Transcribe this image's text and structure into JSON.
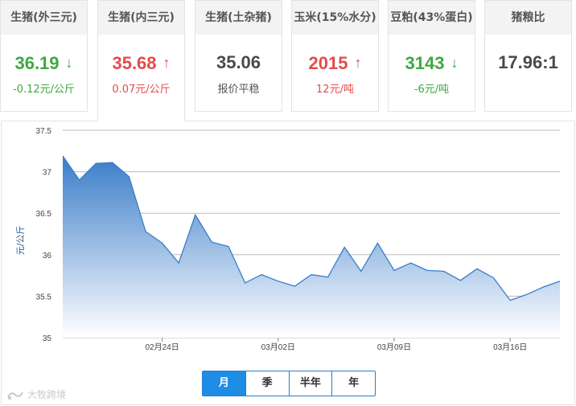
{
  "cards": [
    {
      "id": "pig-outer",
      "title": "生猪(外三元)",
      "value": "36.19",
      "trend": "down",
      "change": "-0.12元/公斤",
      "active": false
    },
    {
      "id": "pig-inner",
      "title": "生猪(内三元)",
      "value": "35.68",
      "trend": "up",
      "change": "0.07元/公斤",
      "active": true
    },
    {
      "id": "pig-local",
      "title": "生猪(土杂猪)",
      "value": "35.06",
      "trend": "flat",
      "change": "报价平稳",
      "active": false
    },
    {
      "id": "corn",
      "title": "玉米(15%水分)",
      "value": "2015",
      "trend": "up",
      "change": "12元/吨",
      "active": false
    },
    {
      "id": "soymeal",
      "title": "豆粕(43%蛋白)",
      "value": "3143",
      "trend": "down",
      "change": "-6元/吨",
      "active": false
    },
    {
      "id": "ratio",
      "title": "猪粮比",
      "value": "17.96:1",
      "trend": "none",
      "change": "",
      "active": false
    }
  ],
  "icons": {
    "up": "arrow-up-icon",
    "down": "arrow-down-icon",
    "logo": "watermark-logo-icon"
  },
  "colors": {
    "up": "#e44b4b",
    "down": "#3fa83f",
    "accent": "#1e8de6",
    "line": "#3a7dc9",
    "fill_top": "#3a7dc9",
    "fill_bottom": "#ffffff",
    "grid": "#bbbbbb"
  },
  "chart_data": {
    "type": "area",
    "title": "",
    "xlabel": "",
    "ylabel": "元/公斤",
    "ylim": [
      35,
      37.5
    ],
    "yticks": [
      35,
      35.5,
      36,
      36.5,
      37,
      37.5
    ],
    "ytick_labels": [
      "35",
      "35.5",
      "36",
      "36.5",
      "37",
      "37.5"
    ],
    "xticks": [
      "02月24日",
      "03月02日",
      "03月09日",
      "03月16日"
    ],
    "xtick_index": [
      6,
      13,
      20,
      27
    ],
    "grid": true,
    "legend": "none",
    "series": [
      {
        "values": [
          37.19,
          36.9,
          37.1,
          37.11,
          36.94,
          36.28,
          36.14,
          35.9,
          36.48,
          36.15,
          36.1,
          35.66,
          35.76,
          35.68,
          35.62,
          35.76,
          35.73,
          36.09,
          35.8,
          36.14,
          35.81,
          35.9,
          35.81,
          35.8,
          35.69,
          35.83,
          35.72,
          35.45,
          35.52,
          35.61,
          35.68
        ]
      }
    ]
  },
  "periods": {
    "items": [
      "月",
      "季",
      "半年",
      "年"
    ],
    "active": "月"
  },
  "watermark": "大牧跨境"
}
